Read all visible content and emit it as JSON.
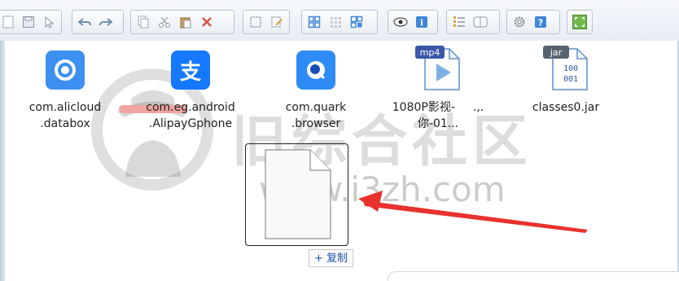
{
  "files": [
    {
      "line1": "com.alicloud",
      "line2": ".databox",
      "icon": "alicloud-databox-app-icon",
      "color": "#3d8ff0"
    },
    {
      "line1": "com.eg.android",
      "line2": ".AlipayGphone",
      "icon": "alipay-app-icon",
      "color": "#1677ff"
    },
    {
      "line1": "com.quark",
      "line2": ".browser",
      "icon": "quark-browser-app-icon",
      "color": "#2f8cf6"
    },
    {
      "line1": "1080P影视-",
      "line2": "你-01...",
      "line1_suffix": ".,.",
      "icon": "mp4-file-icon",
      "badge": "mp4"
    },
    {
      "line1": "classes0.jar",
      "icon": "jar-file-icon",
      "badge": "jar",
      "jar_bits1": "100",
      "jar_bits2": "001"
    }
  ],
  "drag": {
    "copy_label": "+ 复制"
  },
  "watermark": {
    "cn": "旧综合社区",
    "url": "www.i3zh.com"
  },
  "colors": {
    "accent_blue": "#3f86d8",
    "arrow_red": "#e8322e"
  }
}
